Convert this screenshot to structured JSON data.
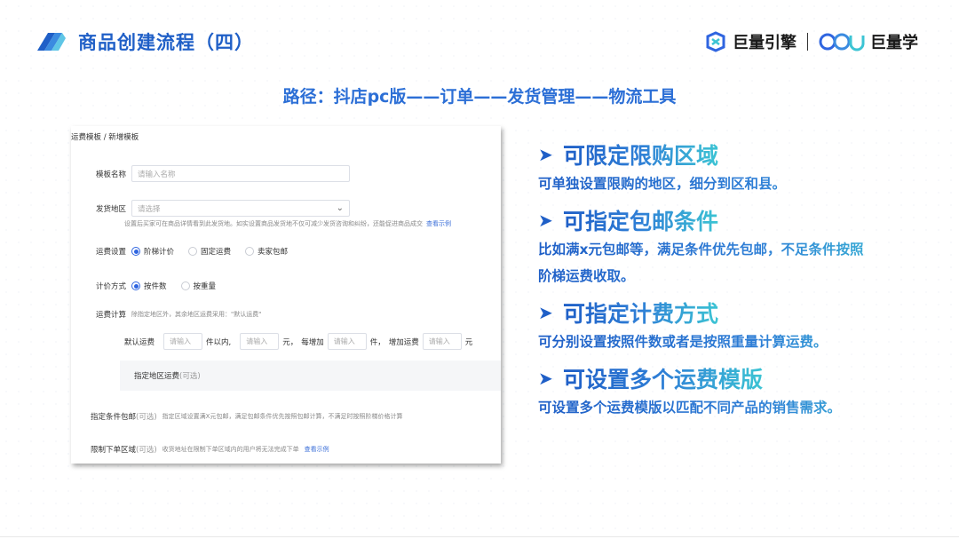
{
  "slide": {
    "title": "商品创建流程（四）",
    "path": "路径：抖店pc版——订单——发货管理——物流工具"
  },
  "brand": {
    "name1": "巨量引擎",
    "name2": "巨量学"
  },
  "form": {
    "breadcrumb": "运费模板 / 新增模板",
    "template_name": {
      "label": "模板名称",
      "placeholder": "请输入名称"
    },
    "ship_region": {
      "label": "发货地区",
      "placeholder": "请选择",
      "hint": "设置后买家可在商品详情看到此发货地。如实设置商品发货地不仅可减少发货咨询和纠纷，还能促进商品成交",
      "link": "查看示例"
    },
    "fee_setting": {
      "label": "运费设置",
      "options": [
        "阶梯计价",
        "固定运费",
        "卖家包邮"
      ],
      "selected": 0
    },
    "pricing_method": {
      "label": "计价方式",
      "options": [
        "按件数",
        "按重量"
      ],
      "selected": 0
    },
    "fee_calc": {
      "label": "运费计算",
      "hint": "除指定地区外，其余地区运费采用：\"默认运费\"",
      "default_label": "默认运费",
      "placeholder": "请输入",
      "within": "件以内,",
      "yuan": "元，",
      "each_add": "每增加",
      "piece": "件，",
      "add_fee": "增加运费",
      "yuan_end": "元"
    },
    "region_fee": {
      "label": "指定地区运费",
      "optional": "(可选)"
    },
    "free_ship": {
      "label": "指定条件包邮",
      "optional": "(可选)",
      "hint": "指定区域设置满X元包邮，满足包邮条件优先按照包邮计算，不满足时按照阶梯价格计算"
    },
    "restrict": {
      "label": "限制下单区域",
      "optional": "(可选)",
      "hint": "收货地址在限制下单区域内的用户将无法完成下单",
      "link": "查看示例"
    }
  },
  "features": [
    {
      "head": "可限定限购区域",
      "desc": [
        "可单独设置限购的地区，细分到区和县。"
      ]
    },
    {
      "head": "可指定包邮条件",
      "desc": [
        "比如满x元包邮等，满足条件优先包邮，不足条件按照",
        "阶梯运费收取。"
      ]
    },
    {
      "head": "可指定计费方式",
      "desc": [
        "可分别设置按照件数或者是按照重量计算运费。"
      ]
    },
    {
      "head": "可设置多个运费模版",
      "desc": [
        "可设置多个运费模版以匹配不同产品的销售需求。"
      ]
    }
  ],
  "colors": {
    "primary": "#1f5fc7",
    "accent": "#3cc4d4",
    "radio": "#2f65e0"
  }
}
